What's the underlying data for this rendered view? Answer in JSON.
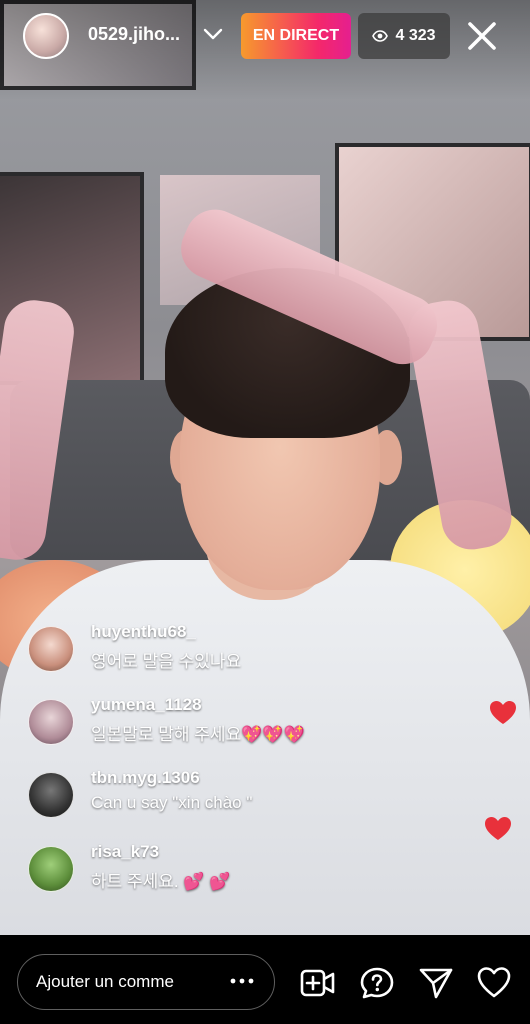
{
  "host": {
    "username": "0529.jiho...",
    "live_label": "EN DIRECT",
    "viewer_count": "4 323"
  },
  "comments": [
    {
      "username": "huyenthu68_",
      "text": "영어로 말을 수있나요"
    },
    {
      "username": "yumena_1128",
      "text": "일본말로 말해 주세요💖💖💖"
    },
    {
      "username": "tbn.myg.1306",
      "text": "Can u say \"xin chào \""
    },
    {
      "username": "risa_k73",
      "text": "하트 주세요. 💕 💕"
    }
  ],
  "comment_box": {
    "placeholder": "Ajouter un comme"
  },
  "icons": [
    "chevron-down-icon",
    "eye-icon",
    "close-icon",
    "more-icon",
    "add-video-icon",
    "question-icon",
    "send-icon",
    "heart-icon"
  ],
  "colors": {
    "live_gradient_start": "#f79a2d",
    "live_gradient_end": "#e51f8f",
    "heart": "#e8313b"
  }
}
